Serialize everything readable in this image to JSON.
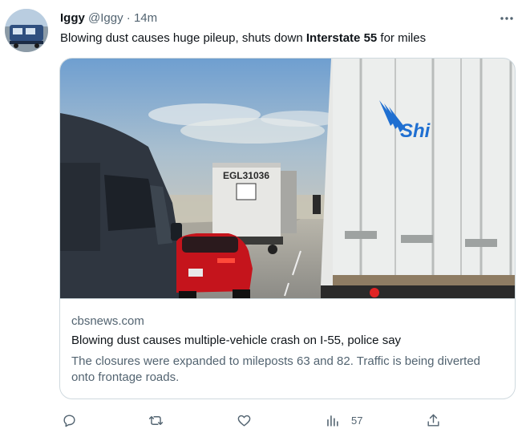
{
  "tweet": {
    "author_name": "Iggy",
    "author_handle": "@Iggy",
    "separator": "·",
    "time": "14m",
    "text_before": "Blowing dust causes huge pileup, shuts down ",
    "text_bold": "Interstate 55",
    "text_after": " for miles"
  },
  "card": {
    "truck_id": "EGL31036",
    "trailer_logo": "Shi",
    "domain": "cbsnews.com",
    "title": "Blowing dust causes multiple-vehicle crash on I-55, police say",
    "description": "The closures were expanded to mileposts 63 and 82. Traffic is being diverted onto frontage roads."
  },
  "actions": {
    "reply_icon": "reply-icon",
    "retweet_icon": "retweet-icon",
    "like_icon": "heart-icon",
    "views_icon": "views-icon",
    "views_count": "57",
    "share_icon": "share-icon"
  },
  "colors": {
    "text_primary": "#0f1419",
    "text_secondary": "#536471",
    "border": "#cfd9de",
    "trailer_logo_blue": "#1f6fd1"
  }
}
